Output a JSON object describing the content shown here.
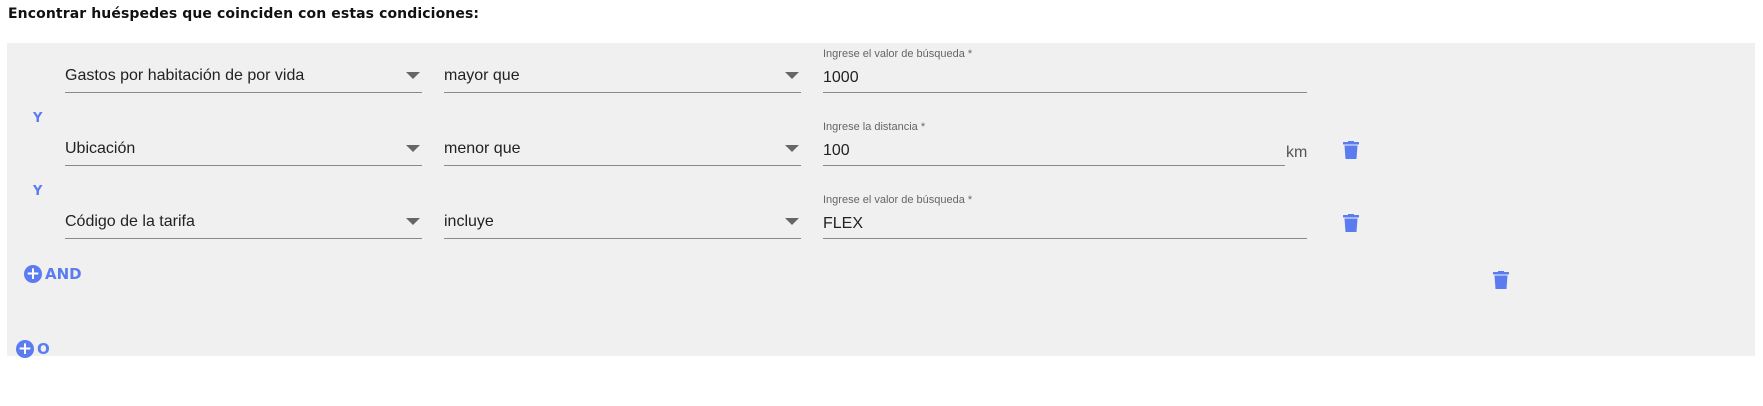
{
  "heading": "Encontrar huéspedes que coinciden con estas condiciones:",
  "colors": {
    "accent": "#5b7cf0",
    "panel_background": "#f0f0f0",
    "underline": "#8a8a8a"
  },
  "conditions": [
    {
      "field": "Gastos por habitación de por vida",
      "operator": "mayor que",
      "value_label": "Ingrese el valor de búsqueda *",
      "value": "1000",
      "unit": "",
      "deletable": false
    },
    {
      "connector": "Y",
      "field": "Ubicación",
      "operator": "menor que",
      "value_label": "Ingrese la distancia *",
      "value": "100",
      "unit": "km",
      "deletable": true
    },
    {
      "connector": "Y",
      "field": "Código de la tarifa",
      "operator": "incluye",
      "value_label": "Ingrese el valor de búsqueda *",
      "value": "FLEX",
      "unit": "",
      "deletable": true
    }
  ],
  "add_and": {
    "icon": "plus-circle-icon",
    "label": "AND"
  },
  "add_or": {
    "icon": "plus-circle-icon",
    "label": "O"
  },
  "icons": {
    "dropdown": "arrow-drop-down-icon",
    "delete": "trash-icon"
  }
}
